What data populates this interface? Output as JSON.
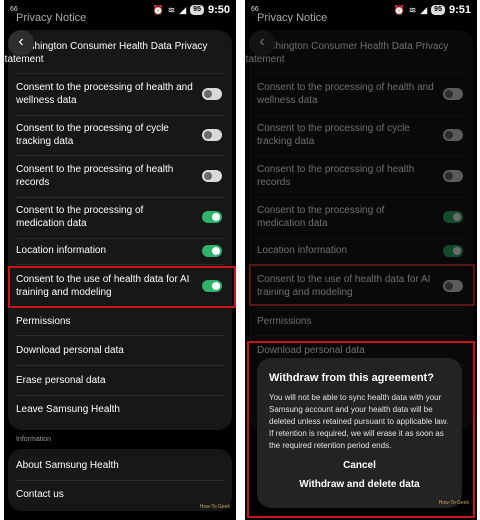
{
  "left": {
    "status": {
      "notif": "66",
      "battery": "95",
      "time": "9:50"
    },
    "header_truncated": "Privacy Notice",
    "rows": [
      {
        "id": "washington",
        "label": "Washington Consumer Health Data Privacy Statement",
        "display": "ashington Consumer Health Data Privacy Statement",
        "toggle": null
      },
      {
        "id": "wellness",
        "label": "Consent to the processing of health and wellness data",
        "toggle": "off"
      },
      {
        "id": "cycle",
        "label": "Consent to the processing of cycle tracking data",
        "toggle": "off"
      },
      {
        "id": "records",
        "label": "Consent to the processing of health records",
        "toggle": "off"
      },
      {
        "id": "medication",
        "label": "Consent to the processing of medication data",
        "toggle": "on"
      },
      {
        "id": "location",
        "label": "Location information",
        "toggle": "on"
      },
      {
        "id": "ai",
        "label": "Consent to the use of health data for AI training and modeling",
        "toggle": "on"
      },
      {
        "id": "permissions",
        "label": "Permissions",
        "toggle": null
      },
      {
        "id": "download",
        "label": "Download personal data",
        "toggle": null
      },
      {
        "id": "erase",
        "label": "Erase personal data",
        "toggle": null
      },
      {
        "id": "leave",
        "label": "Leave Samsung Health",
        "toggle": null
      }
    ],
    "section_label": "Information",
    "info_rows": [
      "About Samsung Health",
      "Contact us"
    ]
  },
  "right": {
    "status": {
      "notif": "66",
      "battery": "95",
      "time": "9:51"
    },
    "ai_toggle": "off",
    "dialog": {
      "title": "Withdraw from this agreement?",
      "body": "You will not be able to sync health data with your Samsung account and your health data will be deleted unless retained pursuant to applicable law. If retention is required, we will erase it as soon as the required retention period ends.",
      "cancel": "Cancel",
      "confirm": "Withdraw and delete data"
    }
  },
  "watermark": "How-To Geek",
  "colors": {
    "highlight": "#c4161c",
    "toggle_on": "#2fb36b",
    "toggle_off": "#d9d9d9"
  }
}
